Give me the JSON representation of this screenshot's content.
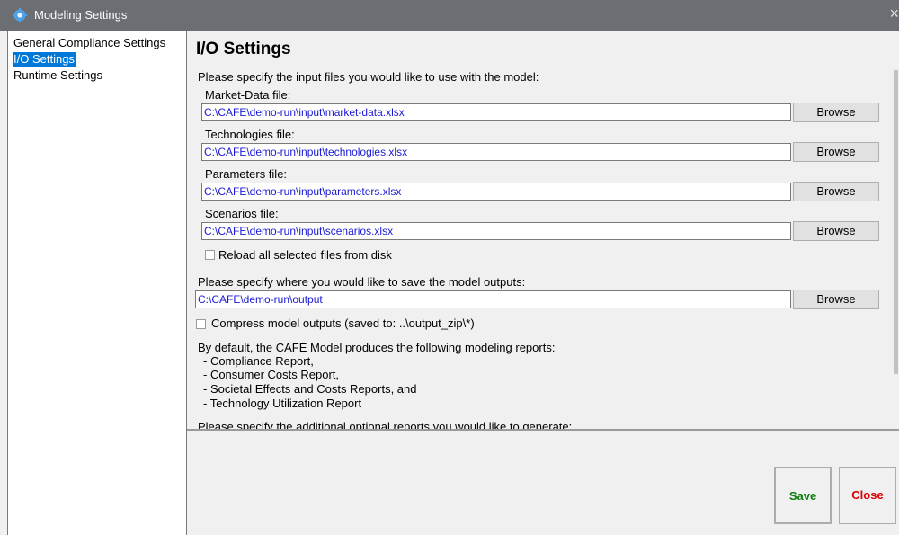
{
  "window": {
    "title": "Modeling Settings",
    "app_icon": "gear-icon",
    "close_glyph": "×"
  },
  "sidebar": {
    "items": [
      {
        "label": "General Compliance Settings",
        "selected": false
      },
      {
        "label": "I/O Settings",
        "selected": true
      },
      {
        "label": "Runtime Settings",
        "selected": false
      }
    ]
  },
  "main": {
    "heading": "I/O Settings",
    "input_prompt": "Please specify the input files you would like to use with the model:",
    "inputs": [
      {
        "label": "Market-Data file:",
        "value": "C:\\CAFE\\demo-run\\input\\market-data.xlsx",
        "button": "Browse"
      },
      {
        "label": "Technologies file:",
        "value": "C:\\CAFE\\demo-run\\input\\technologies.xlsx",
        "button": "Browse"
      },
      {
        "label": "Parameters file:",
        "value": "C:\\CAFE\\demo-run\\input\\parameters.xlsx",
        "button": "Browse"
      },
      {
        "label": "Scenarios file:",
        "value": "C:\\CAFE\\demo-run\\input\\scenarios.xlsx",
        "button": "Browse"
      }
    ],
    "reload_label": "Reload all selected files from disk",
    "reload_checked": false,
    "output_prompt": "Please specify where you would like to save the model outputs:",
    "output_value": "C:\\CAFE\\demo-run\\output",
    "output_button": "Browse",
    "compress_label": "Compress model outputs (saved to: ..\\output_zip\\*)",
    "compress_checked": false,
    "reports_intro": "By default, the CAFE Model produces the following modeling reports:",
    "reports": [
      "- Compliance Report,",
      "- Consumer Costs  Report,",
      "- Societal Effects and Costs Reports, and",
      "- Technology Utilization Report"
    ],
    "optional_prompt": "Please specify the additional optional reports you would like to generate:"
  },
  "actions": {
    "save": "Save",
    "close": "Close"
  },
  "colors": {
    "selected_bg": "#0078d7",
    "path_text": "#1a1ad4",
    "save_text": "#0b7d0b",
    "close_text": "#d60000",
    "titlebar": "#6b6e72"
  }
}
